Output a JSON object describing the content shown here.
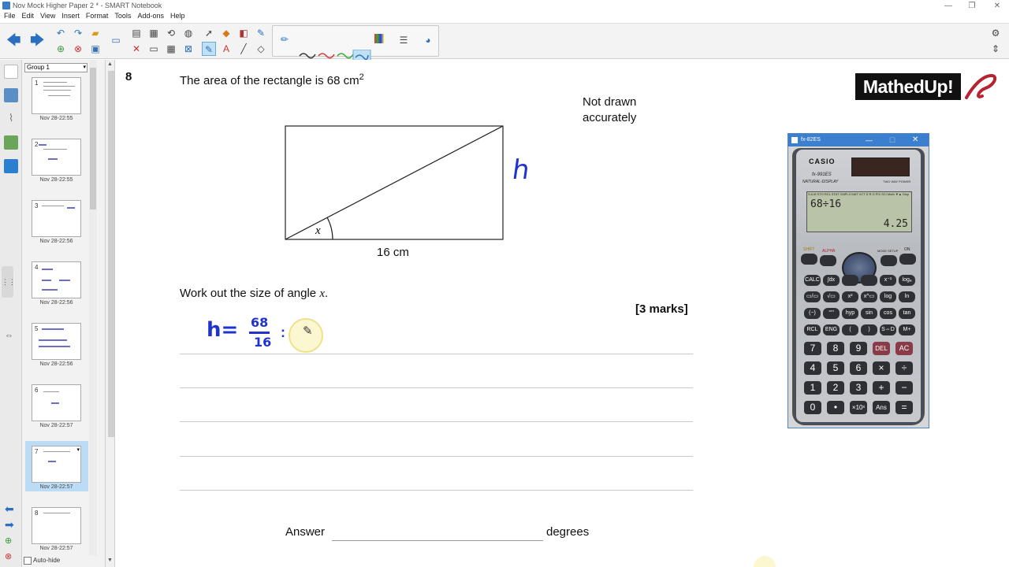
{
  "window": {
    "title": "Nov Mock Higher Paper 2 * - SMART Notebook"
  },
  "menu": [
    "File",
    "Edit",
    "View",
    "Insert",
    "Format",
    "Tools",
    "Add-ons",
    "Help"
  ],
  "sorter": {
    "group": "Group 1",
    "pages": [
      {
        "num": "1",
        "date": "Nov 28-22:55"
      },
      {
        "num": "2",
        "date": "Nov 28-22:55"
      },
      {
        "num": "3",
        "date": "Nov 28-22:56"
      },
      {
        "num": "4",
        "date": "Nov 28-22:56"
      },
      {
        "num": "5",
        "date": "Nov 28-22:56"
      },
      {
        "num": "6",
        "date": "Nov 28-22:57"
      },
      {
        "num": "7",
        "date": "Nov 28-22:57"
      },
      {
        "num": "8",
        "date": "Nov 28-22:57"
      }
    ],
    "autohide": "Auto-hide"
  },
  "question": {
    "number": "8",
    "text_main": "The area of the rectangle is 68 cm",
    "text_sup": "2",
    "note_line1": "Not drawn",
    "note_line2": "accurately",
    "angle_label": "x",
    "base_label": "16 cm",
    "prompt_pre": "Work out the size of angle ",
    "prompt_var": "x",
    "prompt_post": ".",
    "marks": "[3 marks]",
    "answer_label": "Answer",
    "answer_unit": "degrees"
  },
  "handwriting": {
    "side_label": "h",
    "work_lhs": "h=",
    "numerator": "68",
    "denominator": "16",
    "op": ":"
  },
  "logo": {
    "text": "MathedUp!"
  },
  "calculator": {
    "window_title": "fx-82ES",
    "brand": "CASIO",
    "model": "fx-991ES",
    "model_sub": "NATURAL-DISPLAY",
    "power": "TWO WAY POWER",
    "status_line": "S A M STO RCL STAT CMPLX MAT VCT D R G FIX SCI Math ▼▲ Disp",
    "expression": "68÷16",
    "result": "4.25",
    "top_keys": [
      "SHIFT",
      "ALPHA",
      "MODE SETUP",
      "ON"
    ],
    "func_rows": [
      [
        "CALC",
        "∫dx",
        "",
        "",
        "x⁻¹",
        "logₐ"
      ],
      [
        "▭/▭",
        "√▭",
        "x²",
        "x^▭",
        "log",
        "ln"
      ],
      [
        "(−)",
        "°'\"",
        "hyp",
        "sin",
        "cos",
        "tan"
      ],
      [
        "RCL",
        "ENG",
        "(",
        ")",
        "S⇔D",
        "M+"
      ]
    ],
    "num_rows": [
      [
        "7",
        "8",
        "9",
        "DEL",
        "AC"
      ],
      [
        "4",
        "5",
        "6",
        "×",
        "÷"
      ],
      [
        "1",
        "2",
        "3",
        "+",
        "−"
      ],
      [
        "0",
        "•",
        "×10ˣ",
        "Ans",
        "="
      ]
    ]
  },
  "colors": {
    "ink": "#2233cc",
    "accent": "#3c7fce",
    "calc_key": "#2e3036",
    "calc_del": "#8a3b48"
  }
}
